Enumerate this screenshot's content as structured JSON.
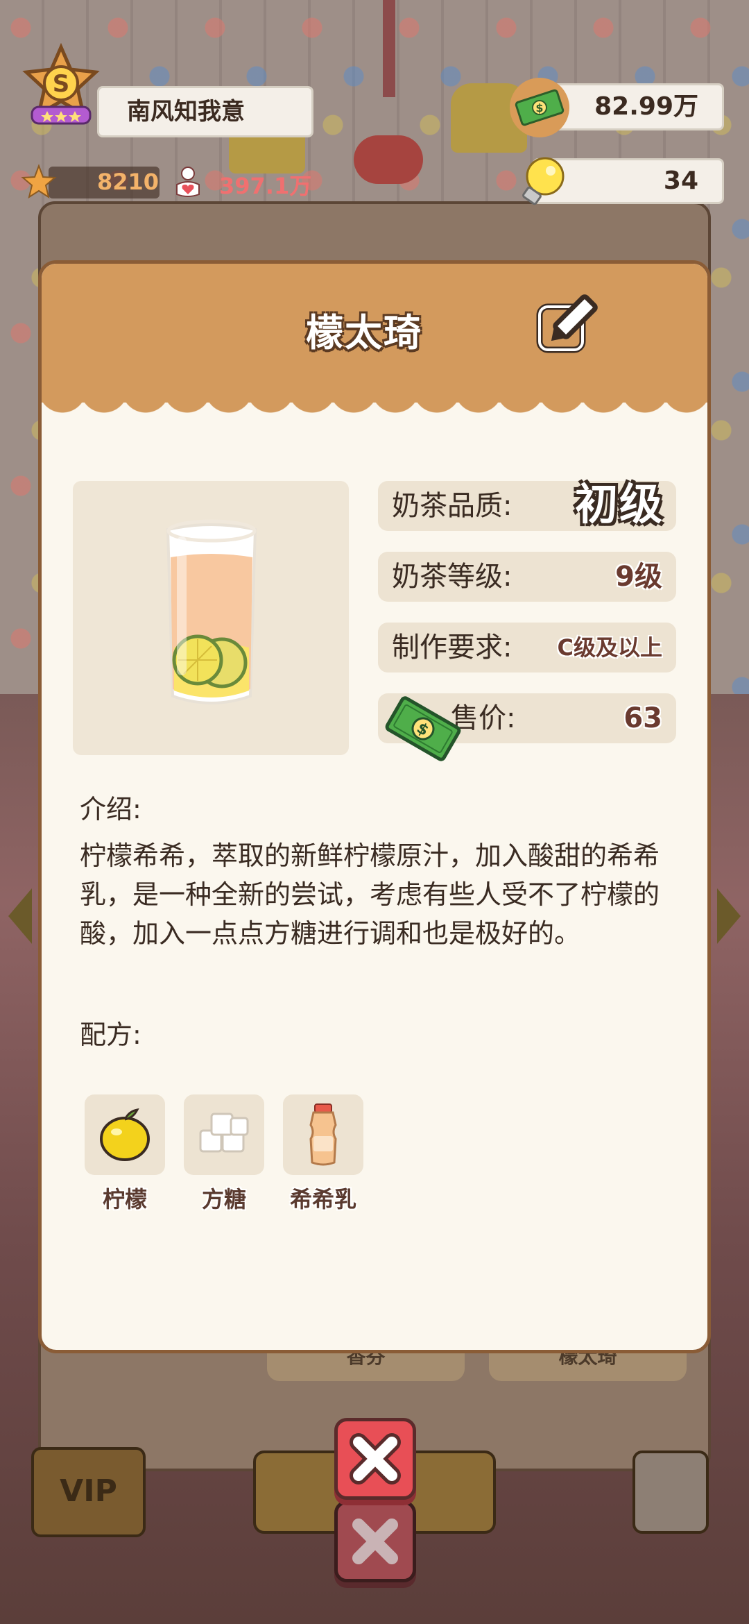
{
  "player": {
    "rank_letter": "S",
    "name": "南风知我意",
    "stars": "8210",
    "fans": "397.1万"
  },
  "currency": {
    "cash": "82.99万",
    "ideas": "34"
  },
  "dialog": {
    "title": "檬太琦",
    "info": {
      "quality_label": "奶茶品质:",
      "quality_value": "初级",
      "level_label": "奶茶等级:",
      "level_value": "9级",
      "requirement_label": "制作要求:",
      "requirement_value": "C级及以上",
      "price_label": "售价:",
      "price_value": "63"
    },
    "intro_label": "介绍:",
    "intro_text": "柠檬希希，萃取的新鲜柠檬原汁，加入酸甜的希希乳，是一种全新的尝试，考虑有些人受不了柠檬的酸，加入一点点方糖进行调和也是极好的。",
    "recipe_label": "配方:",
    "ingredients": [
      {
        "name": "柠檬",
        "icon": "lemon-icon"
      },
      {
        "name": "方糖",
        "icon": "sugar-cube-icon"
      },
      {
        "name": "希希乳",
        "icon": "yogurt-drink-icon"
      }
    ]
  },
  "background": {
    "tab_left": "香芬",
    "tab_right": "檬太琦",
    "vip_label": "VIP"
  },
  "colors": {
    "header": "#d39a5d",
    "panel": "#fbf7ee",
    "close_button": "#e84f56"
  }
}
